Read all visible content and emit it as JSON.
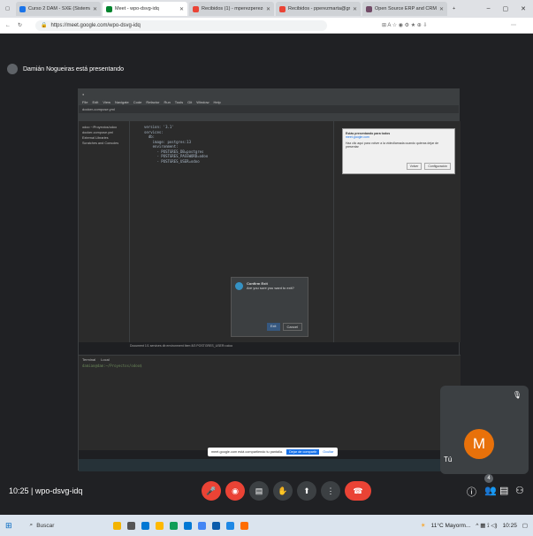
{
  "browser": {
    "tabs": [
      {
        "label": "Curso 2 DAM - SXE (Sistemas de",
        "color": "#1a73e8",
        "active": false
      },
      {
        "label": "Meet - wpo-dsvg-idq",
        "color": "#00832d",
        "active": true
      },
      {
        "label": "Recibidos (1) - mperezperez@",
        "color": "#ea4335",
        "active": false
      },
      {
        "label": "Recibidos - pperezmarta@gmail.",
        "color": "#ea4335",
        "active": false
      },
      {
        "label": "Open Source ERP and CRM | Od",
        "color": "#714b67",
        "active": false
      }
    ],
    "url": "https://meet.google.com/wpo-dsvg-idq"
  },
  "meet": {
    "presenting": "Damián Nogueiras está presentando",
    "meeting_code": "10:25 | wpo-dsvg-idq",
    "self_initial": "M",
    "self_label": "Tú",
    "participant_count": "4"
  },
  "shared_screen": {
    "menu": [
      "File",
      "Edit",
      "View",
      "Navigate",
      "Code",
      "Refactor",
      "Run",
      "Tools",
      "Git",
      "Window",
      "Help"
    ],
    "file_tab": "docker-compose.yml",
    "project_items": [
      "odoo ~/Proyectos/odoo",
      "docker-compose.yml",
      "External Libraries",
      "Scratches and Consoles"
    ],
    "code_lines": [
      "version: '3.1'",
      "services:",
      "  db:",
      "    image: postgres:13",
      "    environment:",
      "      - POSTGRES_DB=postgres",
      "      - POSTGRES_PASSWORD=odoo",
      "      - POSTGRES_USER=odoo"
    ],
    "notification_title": "Estás presentando para todos",
    "notification_site": "meet.google.com",
    "notification_body": "Haz clic aquí para volver a la videollamada cuando quieras dejar de presentar",
    "notification_btn1": "Volver",
    "notification_btn2": "Configuración",
    "dialog_title": "Confirm Exit",
    "dialog_body": "Are you sure you want to exit?",
    "dialog_ok": "Exit",
    "dialog_cancel": "Cancel",
    "breadcrumb": "Document 1/1   services   db   environment   Item 8/3   POSTGRES_USER=odoo",
    "terminal_tab": "Terminal",
    "terminal_local": "Local",
    "terminal_prompt": "damian@dam:~/Proyectos/odoo$",
    "share_notice": "meet.google.com está compartiendo tu pantalla.",
    "stop_share": "Dejar de compartir",
    "hide": "Ocultar"
  },
  "taskbar": {
    "search": "Buscar",
    "weather": "11°C Mayorm...",
    "time": "10:25"
  }
}
